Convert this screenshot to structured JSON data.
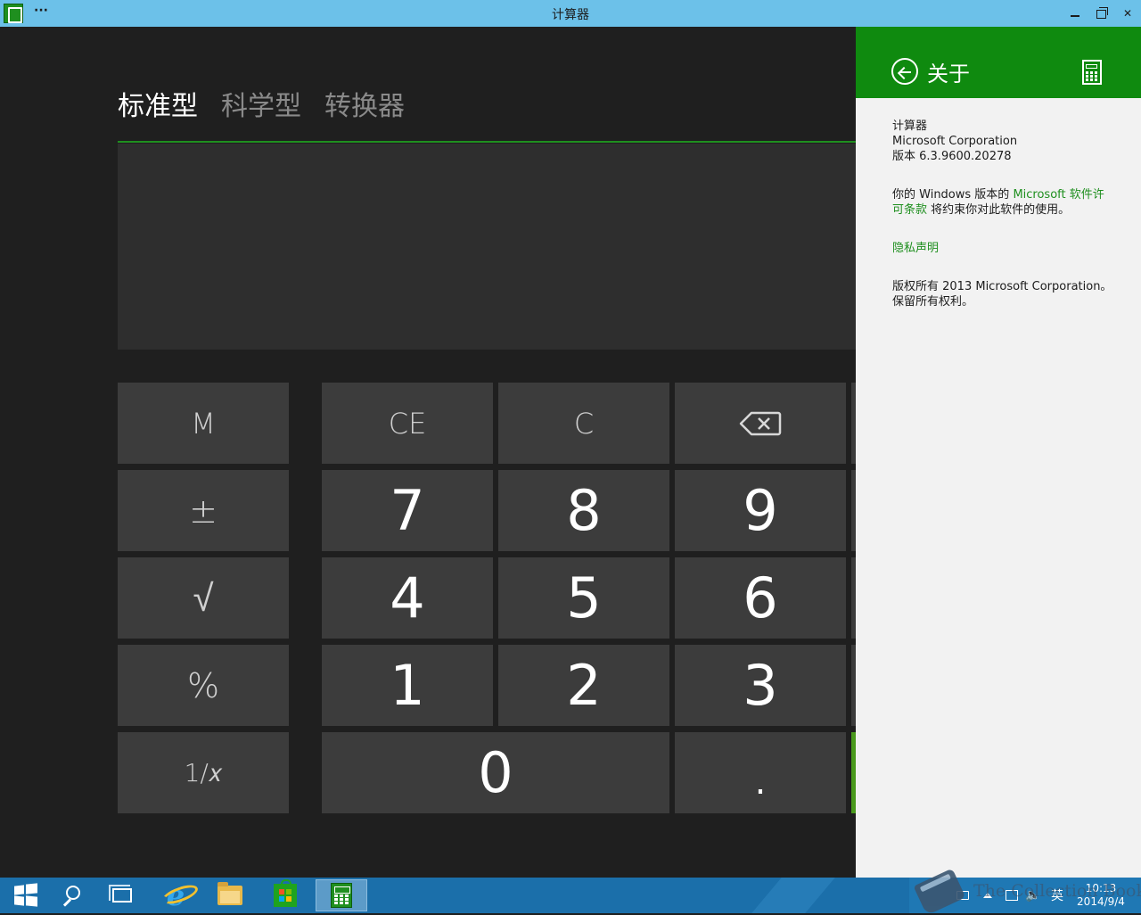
{
  "window": {
    "title": "计算器",
    "menu_dots": "···",
    "controls": {
      "minimize": "minimize",
      "maximize": "restore",
      "close": "close"
    }
  },
  "calculator": {
    "modes": [
      {
        "label": "标准型",
        "active": true
      },
      {
        "label": "科学型",
        "active": false
      },
      {
        "label": "转换器",
        "active": false
      }
    ],
    "display_value": "",
    "keys": {
      "memory": "M",
      "plus_minus": "±",
      "sqrt": "√",
      "percent": "%",
      "reciprocal": "1/𝑥",
      "ce": "CE",
      "clear": "C",
      "backspace": "⌫",
      "n7": "7",
      "n8": "8",
      "n9": "9",
      "n4": "4",
      "n5": "5",
      "n6": "6",
      "n1": "1",
      "n2": "2",
      "n3": "3",
      "n0": "0",
      "dot": "."
    }
  },
  "about_panel": {
    "title": "关于",
    "app_name": "计算器",
    "publisher": "Microsoft Corporation",
    "version": "版本 6.3.9600.20278",
    "license_prefix": "你的 Windows 版本的",
    "license_link": "Microsoft 软件许可条款",
    "license_suffix": "将约束你对此软件的使用。",
    "privacy_link": "隐私声明",
    "copyright": "版权所有 2013 Microsoft Corporation。保留所有权利。",
    "accent_color": "#0f8a0f"
  },
  "taskbar": {
    "items": [
      {
        "name": "start",
        "icon": "windows-logo-icon"
      },
      {
        "name": "search",
        "icon": "search-icon"
      },
      {
        "name": "task-view",
        "icon": "task-view-icon"
      },
      {
        "name": "internet-explorer",
        "icon": "internet-explorer-icon"
      },
      {
        "name": "file-explorer",
        "icon": "folder-icon"
      },
      {
        "name": "store",
        "icon": "store-icon"
      },
      {
        "name": "calculator",
        "icon": "calculator-icon",
        "active": true
      }
    ],
    "tray": {
      "ime": "英",
      "time": "10:13",
      "date": "2014/9/4"
    },
    "color": "#1b6faa"
  },
  "watermark": {
    "text": "The Collection Book"
  }
}
